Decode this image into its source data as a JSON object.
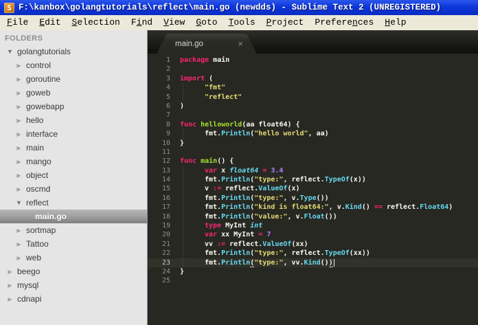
{
  "window": {
    "title": "F:\\kanbox\\golangtutorials\\reflect\\main.go (newdds) - Sublime Text 2 (UNREGISTERED)",
    "icon_letter": "S"
  },
  "menu": {
    "items": [
      {
        "label": "File",
        "accel": 0
      },
      {
        "label": "Edit",
        "accel": 0
      },
      {
        "label": "Selection",
        "accel": 0
      },
      {
        "label": "Find",
        "accel": 1
      },
      {
        "label": "View",
        "accel": 0
      },
      {
        "label": "Goto",
        "accel": 0
      },
      {
        "label": "Tools",
        "accel": 0
      },
      {
        "label": "Project",
        "accel": 0
      },
      {
        "label": "Preferences",
        "accel": 7
      },
      {
        "label": "Help",
        "accel": 0
      }
    ]
  },
  "sidebar": {
    "header": "FOLDERS",
    "items": [
      {
        "label": "golangtutorials",
        "depth": 0,
        "kind": "folder",
        "state": "expanded",
        "selected": false
      },
      {
        "label": "control",
        "depth": 1,
        "kind": "folder",
        "state": "collapsed",
        "selected": false
      },
      {
        "label": "goroutine",
        "depth": 1,
        "kind": "folder",
        "state": "collapsed",
        "selected": false
      },
      {
        "label": "goweb",
        "depth": 1,
        "kind": "folder",
        "state": "collapsed",
        "selected": false
      },
      {
        "label": "gowebapp",
        "depth": 1,
        "kind": "folder",
        "state": "collapsed",
        "selected": false
      },
      {
        "label": "hello",
        "depth": 1,
        "kind": "folder",
        "state": "collapsed",
        "selected": false
      },
      {
        "label": "interface",
        "depth": 1,
        "kind": "folder",
        "state": "collapsed",
        "selected": false
      },
      {
        "label": "main",
        "depth": 1,
        "kind": "folder",
        "state": "collapsed",
        "selected": false
      },
      {
        "label": "mango",
        "depth": 1,
        "kind": "folder",
        "state": "collapsed",
        "selected": false
      },
      {
        "label": "object",
        "depth": 1,
        "kind": "folder",
        "state": "collapsed",
        "selected": false
      },
      {
        "label": "oscmd",
        "depth": 1,
        "kind": "folder",
        "state": "collapsed",
        "selected": false
      },
      {
        "label": "reflect",
        "depth": 1,
        "kind": "folder",
        "state": "expanded",
        "selected": false
      },
      {
        "label": "main.go",
        "depth": 2,
        "kind": "file",
        "state": "none",
        "selected": true
      },
      {
        "label": "sortmap",
        "depth": 1,
        "kind": "folder",
        "state": "collapsed",
        "selected": false
      },
      {
        "label": "Tattoo",
        "depth": 1,
        "kind": "folder",
        "state": "collapsed",
        "selected": false
      },
      {
        "label": "web",
        "depth": 1,
        "kind": "folder",
        "state": "collapsed",
        "selected": false
      },
      {
        "label": "beego",
        "depth": 0,
        "kind": "folder",
        "state": "collapsed",
        "selected": false
      },
      {
        "label": "mysql",
        "depth": 0,
        "kind": "folder",
        "state": "collapsed",
        "selected": false
      },
      {
        "label": "cdnapi",
        "depth": 0,
        "kind": "folder",
        "state": "collapsed",
        "selected": false
      }
    ]
  },
  "tabs": [
    {
      "label": "main.go",
      "close_glyph": "×",
      "active": true
    }
  ],
  "editor": {
    "language": "go",
    "lines": [
      {
        "n": 1,
        "indent": 0,
        "segs": [
          [
            "kw",
            "package"
          ],
          [
            "pl",
            " main"
          ]
        ]
      },
      {
        "n": 2,
        "indent": 0,
        "segs": []
      },
      {
        "n": 3,
        "indent": 0,
        "segs": [
          [
            "kw",
            "import"
          ],
          [
            "pl",
            " ("
          ]
        ]
      },
      {
        "n": 4,
        "indent": 1,
        "segs": [
          [
            "str",
            "\"fmt\""
          ]
        ]
      },
      {
        "n": 5,
        "indent": 1,
        "segs": [
          [
            "str",
            "\"reflect\""
          ]
        ]
      },
      {
        "n": 6,
        "indent": 0,
        "segs": [
          [
            "pl",
            ")"
          ]
        ]
      },
      {
        "n": 7,
        "indent": 0,
        "segs": []
      },
      {
        "n": 8,
        "indent": 0,
        "segs": [
          [
            "kw",
            "func"
          ],
          [
            "fn",
            " helloworld"
          ],
          [
            "pl",
            "(aa float64) {"
          ]
        ]
      },
      {
        "n": 9,
        "indent": 1,
        "segs": [
          [
            "pl",
            "fmt."
          ],
          [
            "call",
            "Println"
          ],
          [
            "pl",
            "("
          ],
          [
            "str",
            "\"hello world\""
          ],
          [
            "pl",
            ", aa)"
          ]
        ]
      },
      {
        "n": 10,
        "indent": 0,
        "segs": [
          [
            "pl",
            "}"
          ]
        ]
      },
      {
        "n": 11,
        "indent": 0,
        "segs": []
      },
      {
        "n": 12,
        "indent": 0,
        "segs": [
          [
            "kw",
            "func"
          ],
          [
            "fn",
            " main"
          ],
          [
            "pl",
            "() {"
          ]
        ]
      },
      {
        "n": 13,
        "indent": 1,
        "segs": [
          [
            "kw",
            "var"
          ],
          [
            "pl",
            " x "
          ],
          [
            "typ",
            "float64"
          ],
          [
            "pl",
            " "
          ],
          [
            "op",
            "="
          ],
          [
            "pl",
            " "
          ],
          [
            "num",
            "3.4"
          ]
        ]
      },
      {
        "n": 14,
        "indent": 1,
        "segs": [
          [
            "pl",
            "fmt."
          ],
          [
            "call",
            "Println"
          ],
          [
            "pl",
            "("
          ],
          [
            "str",
            "\"type:\""
          ],
          [
            "pl",
            ", reflect."
          ],
          [
            "call",
            "TypeOf"
          ],
          [
            "pl",
            "(x))"
          ]
        ]
      },
      {
        "n": 15,
        "indent": 1,
        "segs": [
          [
            "pl",
            "v "
          ],
          [
            "op",
            ":="
          ],
          [
            "pl",
            " reflect."
          ],
          [
            "call",
            "ValueOf"
          ],
          [
            "pl",
            "(x)"
          ]
        ]
      },
      {
        "n": 16,
        "indent": 1,
        "segs": [
          [
            "pl",
            "fmt."
          ],
          [
            "call",
            "Println"
          ],
          [
            "pl",
            "("
          ],
          [
            "str",
            "\"type:\""
          ],
          [
            "pl",
            ", v."
          ],
          [
            "call",
            "Type"
          ],
          [
            "pl",
            "())"
          ]
        ]
      },
      {
        "n": 17,
        "indent": 1,
        "segs": [
          [
            "pl",
            "fmt."
          ],
          [
            "call",
            "Println"
          ],
          [
            "pl",
            "("
          ],
          [
            "str",
            "\"kind is float64:\""
          ],
          [
            "pl",
            ", v."
          ],
          [
            "call",
            "Kind"
          ],
          [
            "pl",
            "() "
          ],
          [
            "op",
            "=="
          ],
          [
            "pl",
            " reflect."
          ],
          [
            "call",
            "Float64"
          ],
          [
            "pl",
            ")"
          ]
        ]
      },
      {
        "n": 18,
        "indent": 1,
        "segs": [
          [
            "pl",
            "fmt."
          ],
          [
            "call",
            "Println"
          ],
          [
            "pl",
            "("
          ],
          [
            "str",
            "\"value:\""
          ],
          [
            "pl",
            ", v."
          ],
          [
            "call",
            "Float"
          ],
          [
            "pl",
            "())"
          ]
        ]
      },
      {
        "n": 19,
        "indent": 1,
        "segs": [
          [
            "kw",
            "type"
          ],
          [
            "pl",
            " MyInt "
          ],
          [
            "typ",
            "int"
          ]
        ]
      },
      {
        "n": 20,
        "indent": 1,
        "segs": [
          [
            "kw",
            "var"
          ],
          [
            "pl",
            " xx MyInt "
          ],
          [
            "op",
            "="
          ],
          [
            "pl",
            " "
          ],
          [
            "num",
            "7"
          ]
        ]
      },
      {
        "n": 21,
        "indent": 1,
        "segs": [
          [
            "pl",
            "vv "
          ],
          [
            "op",
            ":="
          ],
          [
            "pl",
            " reflect."
          ],
          [
            "call",
            "ValueOf"
          ],
          [
            "pl",
            "(xx)"
          ]
        ]
      },
      {
        "n": 22,
        "indent": 1,
        "segs": [
          [
            "pl",
            "fmt."
          ],
          [
            "call",
            "Println"
          ],
          [
            "pl",
            "("
          ],
          [
            "str",
            "\"type:\""
          ],
          [
            "pl",
            ", reflect."
          ],
          [
            "call",
            "TypeOf"
          ],
          [
            "pl",
            "(xx))"
          ]
        ]
      },
      {
        "n": 23,
        "indent": 1,
        "current": true,
        "caret": true,
        "segs": [
          [
            "pl",
            "fmt."
          ],
          [
            "call",
            "Println"
          ],
          [
            "plu",
            "("
          ],
          [
            "str",
            "\"type:\""
          ],
          [
            "pl",
            ", vv."
          ],
          [
            "call",
            "Kind"
          ],
          [
            "pl",
            "()"
          ],
          [
            "plu",
            ")"
          ]
        ]
      },
      {
        "n": 24,
        "indent": 0,
        "segs": [
          [
            "pl",
            "}"
          ]
        ]
      },
      {
        "n": 25,
        "indent": 0,
        "segs": []
      }
    ]
  },
  "theme": {
    "title-bar-blue": "#0e36da",
    "menu-bar-bg": "#ece9d8",
    "sidebar-bg": "#e5e5e5",
    "editor-bg": "#272822",
    "line-number": "#8f908a",
    "keyword": "#f92672",
    "function-name": "#a6e22e",
    "string": "#e6db74",
    "number": "#ae81ff",
    "type-italic": "#66d9ef",
    "builtin-call": "#66d9ef",
    "plain-text": "#f8f8f2"
  }
}
